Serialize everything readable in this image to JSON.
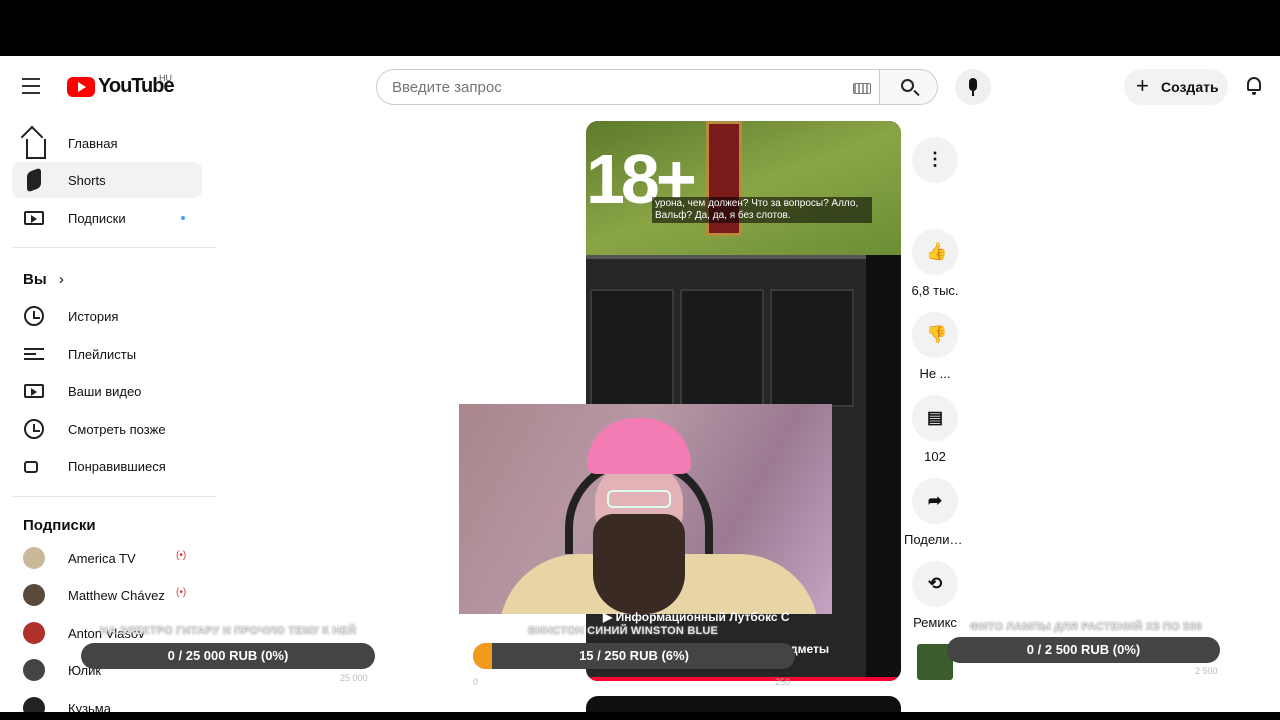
{
  "header": {
    "logo_text": "YouTube",
    "region": "HU",
    "search_placeholder": "Введите запрос",
    "create_label": "Создать"
  },
  "sidebar": {
    "main_items": [
      {
        "label": "Главная",
        "icon": "home-icon"
      },
      {
        "label": "Shorts",
        "icon": "shorts-icon"
      },
      {
        "label": "Подписки",
        "icon": "subscriptions-icon"
      }
    ],
    "you_title": "Вы",
    "you_items": [
      {
        "label": "История",
        "icon": "history-icon"
      },
      {
        "label": "Плейлисты",
        "icon": "playlists-icon"
      },
      {
        "label": "Ваши видео",
        "icon": "your-videos-icon"
      },
      {
        "label": "Смотреть позже",
        "icon": "watch-later-icon"
      },
      {
        "label": "Понравившиеся",
        "icon": "liked-icon"
      }
    ],
    "subs_title": "Подписки",
    "subscriptions": [
      {
        "label": "America TV",
        "live": "(•)"
      },
      {
        "label": "Matthew Chávez",
        "live": "(•)"
      },
      {
        "label": "Anton Vlasov"
      },
      {
        "label": "Юлик"
      },
      {
        "label": "Кузьма"
      }
    ]
  },
  "short": {
    "age_badge": "18+",
    "subtitle": "урона, чем должен? Что за вопросы? Алло, Вальф? Да, да, я без слотов.",
    "video_caption_1": "▶ Информационный Лутбокс С",
    "video_caption_2": "дметы"
  },
  "actions": {
    "likes": "6,8 тыс.",
    "dislike": "Не ...",
    "comments": "102",
    "share": "Поделиться",
    "remix": "Ремикс"
  },
  "goals": [
    {
      "title": "НА ЭЛЕКТРО ГИТАРУ И ПРОЧУЮ ТЕМУ К НЕЙ",
      "text": "0 / 25 000 RUB (0%)",
      "progress": 0,
      "min": "0",
      "max": "25 000"
    },
    {
      "title": "ВИНСТОН СИНИЙ WINSTON BLUE",
      "text": "15 / 250 RUB (6%)",
      "progress": 6,
      "min": "0",
      "max": "250"
    },
    {
      "title": "ФИТО ЛАМПЫ ДЛЯ РАСТЕНИЙ X5 ПО 500",
      "text": "0 / 2 500 RUB (0%)",
      "progress": 0,
      "min": "0",
      "max": "2 500"
    }
  ],
  "colors": {
    "accent": "#ff0000",
    "goal_fill": "#f39a1a",
    "live": "#dd3333",
    "new_dot": "#3ea6ff"
  }
}
